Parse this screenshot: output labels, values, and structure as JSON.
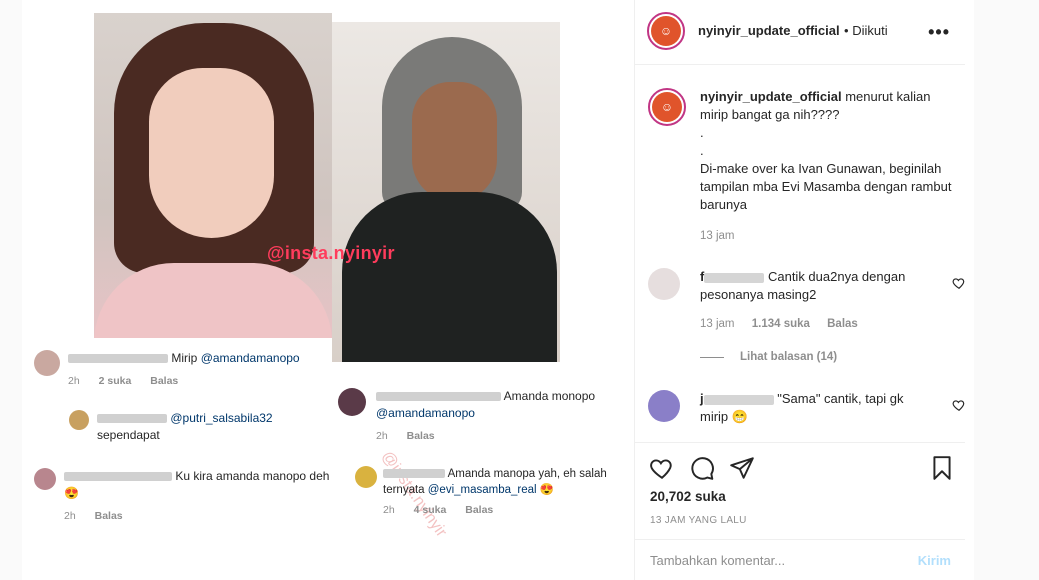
{
  "media": {
    "watermark": "@insta.nyinyir",
    "watermark_diag": "@insta.nyinyir",
    "comments": [
      {
        "text": "Mirip ",
        "mention": "@amandamanopo",
        "time": "2h",
        "likes": "2 suka",
        "reply": "Balas"
      },
      {
        "mention": "@putri_salsabila32",
        "text2": "sependapat"
      },
      {
        "text": "Amanda monopo",
        "mention": "@amandamanopo",
        "time": "2h",
        "reply": "Balas"
      },
      {
        "text": "Ku kira amanda manopo deh",
        "emoji": "😍",
        "time": "2h",
        "reply": "Balas"
      },
      {
        "text": "Amanda manopa yah, eh salah",
        "text2": "ternyata ",
        "mention": "@evi_masamba_real",
        "emoji": "😍",
        "time": "2h",
        "likes": "4 suka",
        "reply": "Balas"
      }
    ]
  },
  "header": {
    "username": "nyinyir_update_official",
    "follow": "• Diikuti",
    "more": "•••"
  },
  "caption": {
    "username": "nyinyir_update_official",
    "text": " menurut kalian mirip bangat ga nih????\n.\n.\nDi-make over ka Ivan Gunawan, beginilah tampilan mba Evi Masamba dengan rambut barunya",
    "time": "13 jam"
  },
  "comments": [
    {
      "username_visible": "f",
      "text": "Cantik dua2nya dengan pesonanya masing2",
      "time": "13 jam",
      "likes": "1.134 suka",
      "reply": "Balas",
      "view_replies": "Lihat balasan (14)"
    },
    {
      "username_visible": "j",
      "text": "\"Sama\" cantik, tapi gk mirip",
      "emoji": "😁"
    }
  ],
  "post": {
    "likes": "20,702 suka",
    "ago": "13 JAM YANG LALU"
  },
  "comment_box": {
    "placeholder": "Tambahkan komentar...",
    "post_label": "Kirim"
  },
  "colors": {
    "watermark": "#ff3c5c",
    "link": "#00376b",
    "muted": "#8e8e8e",
    "post_button_disabled": "#b2dffc",
    "avatar_ring": "#c13584"
  }
}
